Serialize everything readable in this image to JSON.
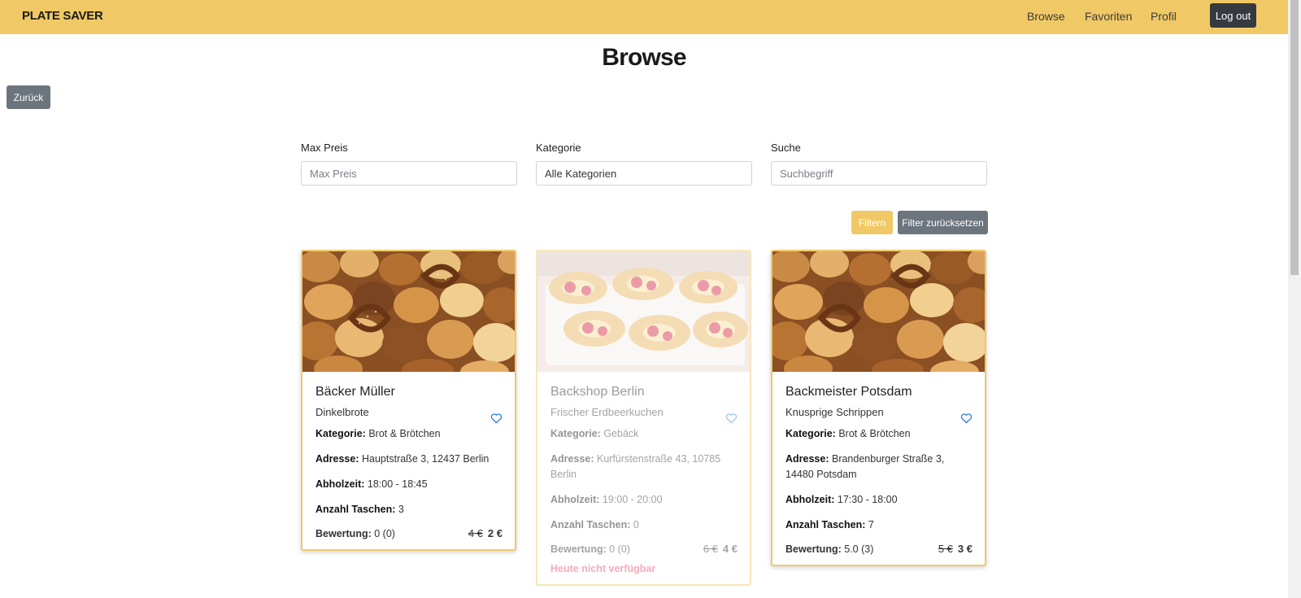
{
  "navbar": {
    "brand": "PLATE SAVER",
    "links": [
      "Browse",
      "Favoriten",
      "Profil"
    ],
    "logout_label": "Log out"
  },
  "page": {
    "title": "Browse",
    "back_label": "Zurück"
  },
  "filters": {
    "max_price_label": "Max Preis",
    "max_price_placeholder": "Max Preis",
    "category_label": "Kategorie",
    "category_value": "Alle Kategorien",
    "search_label": "Suche",
    "search_placeholder": "Suchbegriff",
    "filter_button": "Filtern",
    "reset_button": "Filter zurücksetzen"
  },
  "labels": {
    "category": "Kategorie:",
    "address": "Adresse:",
    "pickup": "Abholzeit:",
    "bags": "Anzahl Taschen:",
    "rating": "Bewertung:"
  },
  "cards": [
    {
      "title": "Bäcker Müller",
      "subtitle": "Dinkelbrote",
      "category": "Brot & Brötchen",
      "address": "Hauptstraße 3, 12437 Berlin",
      "pickup": "18:00 - 18:45",
      "bags": "3",
      "rating": "0 (0)",
      "old_price": "4 €",
      "new_price": "2 €",
      "image": "bread-assortment-image",
      "available": true,
      "unavailable_text": ""
    },
    {
      "title": "Backshop Berlin",
      "subtitle": "Frischer Erdbeerkuchen",
      "category": "Gebäck",
      "address": "Kurfürstenstraße 43, 10785 Berlin",
      "pickup": "19:00 - 20:00",
      "bags": "0",
      "rating": "0 (0)",
      "old_price": "6 €",
      "new_price": "4 €",
      "image": "strawberry-pastry-image",
      "available": false,
      "unavailable_text": "Heute nicht verfügbar"
    },
    {
      "title": "Backmeister Potsdam",
      "subtitle": "Knusprige Schrippen",
      "category": "Brot & Brötchen",
      "address": "Brandenburger Straße 3, 14480 Potsdam",
      "pickup": "17:30 - 18:00",
      "bags": "7",
      "rating": "5.0 (3)",
      "old_price": "5 €",
      "new_price": "3 €",
      "image": "bread-assortment-image",
      "available": true,
      "unavailable_text": ""
    }
  ],
  "colors": {
    "navbar": "#f0c966",
    "dark_button": "#343a40",
    "secondary_button": "#6c757d",
    "heart": "#2f7de1",
    "unavailable": "#e8476a"
  }
}
